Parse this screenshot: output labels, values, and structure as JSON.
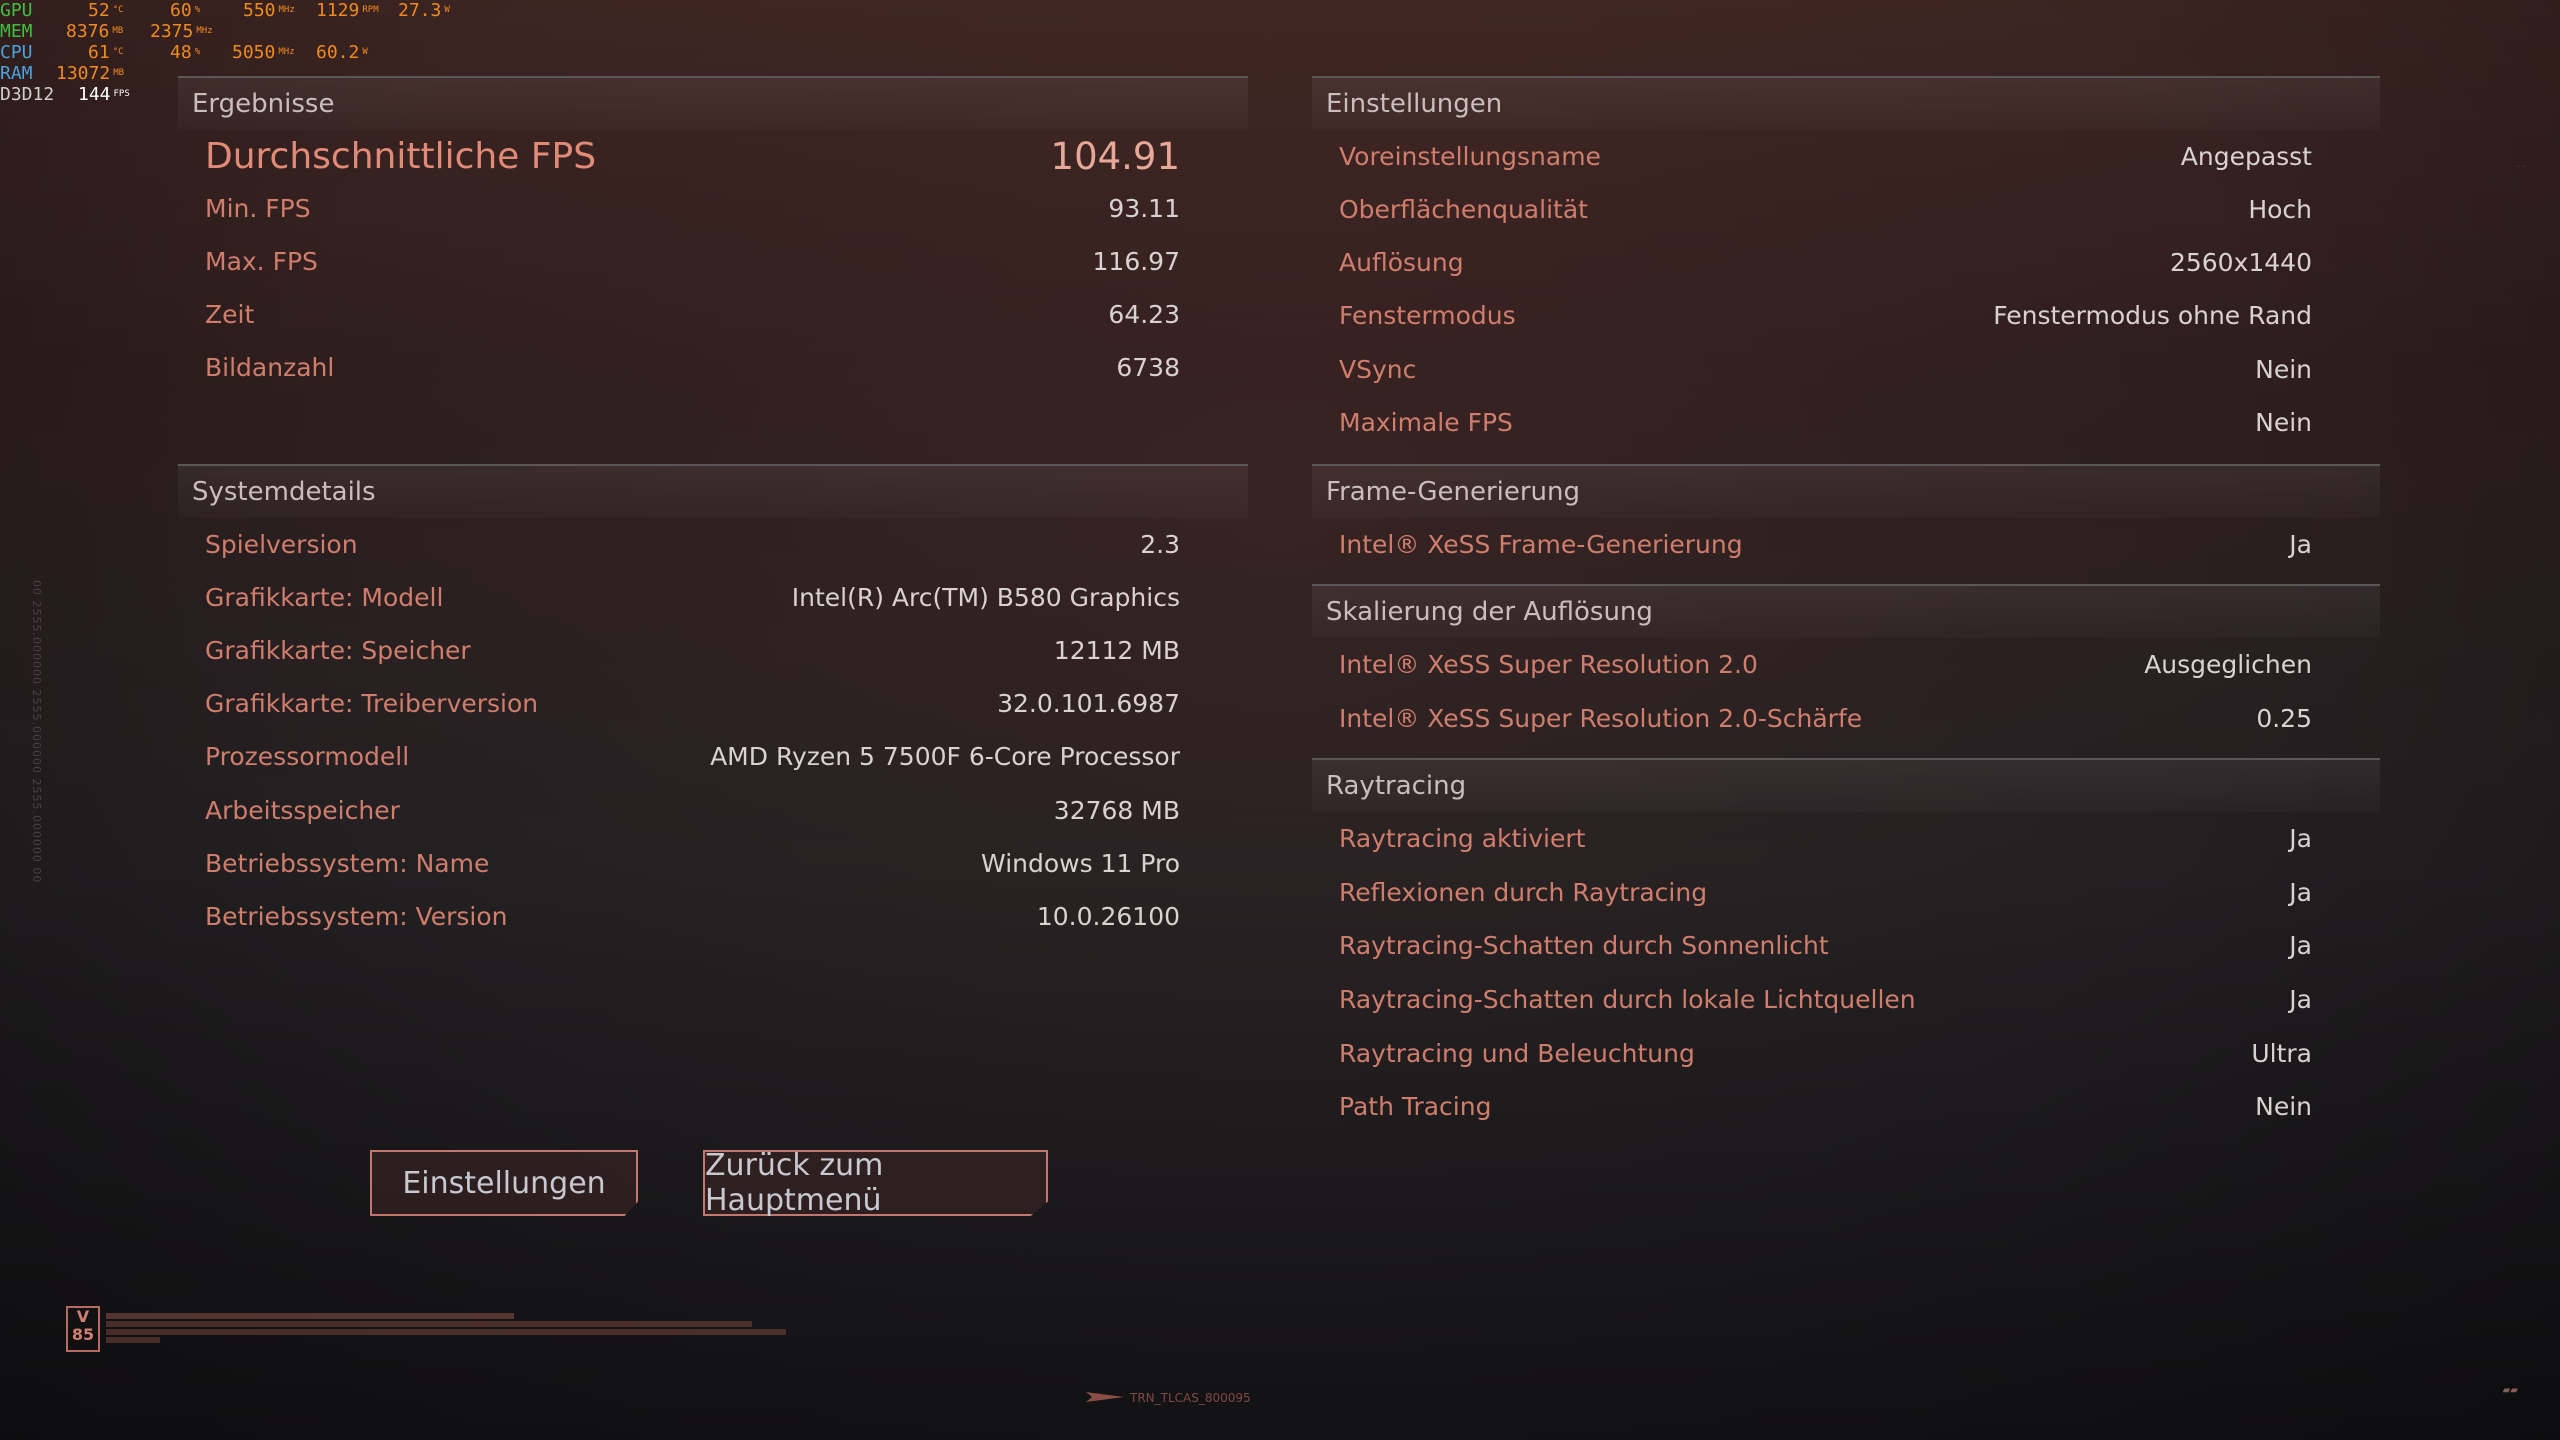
{
  "overlay": {
    "rows": [
      {
        "label": "GPU",
        "values": [
          {
            "v": "52",
            "u": "°C"
          },
          {
            "v": "60",
            "u": "%"
          },
          {
            "v": "550",
            "u": "MHz"
          },
          {
            "v": "1129",
            "u": "RPM"
          },
          {
            "v": "27.3",
            "u": "W"
          }
        ]
      },
      {
        "label": "MEM",
        "values": [
          {
            "v": "8376",
            "u": "MB"
          },
          {
            "v": "2375",
            "u": "MHz"
          }
        ]
      },
      {
        "label": "CPU",
        "values": [
          {
            "v": "61",
            "u": "°C"
          },
          {
            "v": "48",
            "u": "%"
          },
          {
            "v": "5050",
            "u": "MHz"
          },
          {
            "v": "60.2",
            "u": "W"
          }
        ]
      },
      {
        "label": "RAM",
        "values": [
          {
            "v": "13072",
            "u": "MB"
          }
        ]
      },
      {
        "label": "D3D12",
        "values": [
          {
            "v": "144",
            "u": "FPS"
          }
        ]
      }
    ]
  },
  "results": {
    "title": "Ergebnisse",
    "avg_fps": {
      "label": "Durchschnittliche FPS",
      "value": "104.91"
    },
    "rows": [
      {
        "label": "Min. FPS",
        "value": "93.11"
      },
      {
        "label": "Max. FPS",
        "value": "116.97"
      },
      {
        "label": "Zeit",
        "value": "64.23"
      },
      {
        "label": "Bildanzahl",
        "value": "6738"
      }
    ]
  },
  "system": {
    "title": "Systemdetails",
    "rows": [
      {
        "label": "Spielversion",
        "value": "2.3"
      },
      {
        "label": "Grafikkarte: Modell",
        "value": "Intel(R) Arc(TM) B580 Graphics"
      },
      {
        "label": "Grafikkarte: Speicher",
        "value": "12112 MB"
      },
      {
        "label": "Grafikkarte: Treiberversion",
        "value": "32.0.101.6987"
      },
      {
        "label": "Prozessormodell",
        "value": "AMD Ryzen 5 7500F 6-Core Processor"
      },
      {
        "label": "Arbeitsspeicher",
        "value": "32768 MB"
      },
      {
        "label": "Betriebssystem: Name",
        "value": "Windows 11 Pro"
      },
      {
        "label": "Betriebssystem: Version",
        "value": "10.0.26100"
      }
    ]
  },
  "settings": {
    "title": "Einstellungen",
    "rows": [
      {
        "label": "Voreinstellungsname",
        "value": "Angepasst"
      },
      {
        "label": "Oberflächenqualität",
        "value": "Hoch"
      },
      {
        "label": "Auflösung",
        "value": "2560x1440"
      },
      {
        "label": "Fenstermodus",
        "value": "Fenstermodus ohne Rand"
      },
      {
        "label": "VSync",
        "value": "Nein"
      },
      {
        "label": "Maximale FPS",
        "value": "Nein"
      }
    ]
  },
  "frame_gen": {
    "title": "Frame-Generierung",
    "rows": [
      {
        "label": "Intel® XeSS Frame-Generierung",
        "value": "Ja"
      }
    ]
  },
  "scaling": {
    "title": "Skalierung der Auflösung",
    "rows": [
      {
        "label": "Intel® XeSS Super Resolution 2.0",
        "value": "Ausgeglichen"
      },
      {
        "label": "Intel® XeSS Super Resolution 2.0-Schärfe",
        "value": "0.25"
      }
    ]
  },
  "raytracing": {
    "title": "Raytracing",
    "rows": [
      {
        "label": "Raytracing aktiviert",
        "value": "Ja"
      },
      {
        "label": "Reflexionen durch Raytracing",
        "value": "Ja"
      },
      {
        "label": "Raytracing-Schatten durch Sonnenlicht",
        "value": "Ja"
      },
      {
        "label": "Raytracing-Schatten durch lokale Lichtquellen",
        "value": "Ja"
      },
      {
        "label": "Raytracing und Beleuchtung",
        "value": "Ultra"
      },
      {
        "label": "Path Tracing",
        "value": "Nein"
      }
    ]
  },
  "buttons": {
    "settings": "Einstellungen",
    "back": "Zurück zum Hauptmenü"
  },
  "footer": {
    "badge": "V 85",
    "code": "TRN_TLCAS_800095"
  }
}
